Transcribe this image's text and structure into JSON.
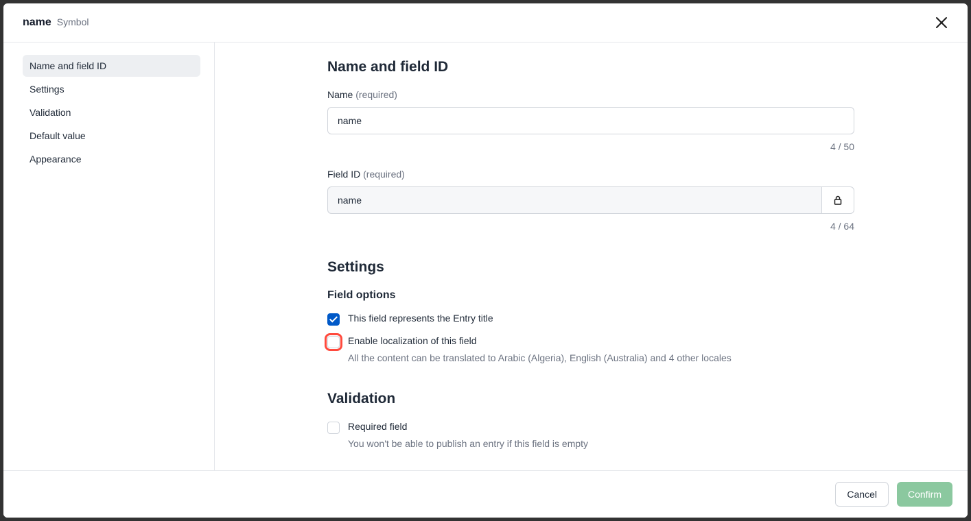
{
  "header": {
    "title": "name",
    "type": "Symbol"
  },
  "sidebar": {
    "items": [
      {
        "label": "Name and field ID",
        "active": true
      },
      {
        "label": "Settings",
        "active": false
      },
      {
        "label": "Validation",
        "active": false
      },
      {
        "label": "Default value",
        "active": false
      },
      {
        "label": "Appearance",
        "active": false
      }
    ]
  },
  "sections": {
    "nameFieldId": {
      "title": "Name and field ID",
      "name": {
        "label": "Name",
        "required": "(required)",
        "value": "name",
        "count": "4 / 50"
      },
      "fieldId": {
        "label": "Field ID",
        "required": "(required)",
        "value": "name",
        "count": "4 / 64"
      }
    },
    "settings": {
      "title": "Settings",
      "subtitle": "Field options",
      "entryTitle": {
        "label": "This field represents the Entry title",
        "checked": true
      },
      "localization": {
        "label": "Enable localization of this field",
        "checked": false,
        "desc": "All the content can be translated to Arabic (Algeria), English (Australia) and 4 other locales"
      }
    },
    "validation": {
      "title": "Validation",
      "required": {
        "label": "Required field",
        "checked": false,
        "desc": "You won't be able to publish an entry if this field is empty"
      }
    }
  },
  "footer": {
    "cancel": "Cancel",
    "confirm": "Confirm"
  }
}
